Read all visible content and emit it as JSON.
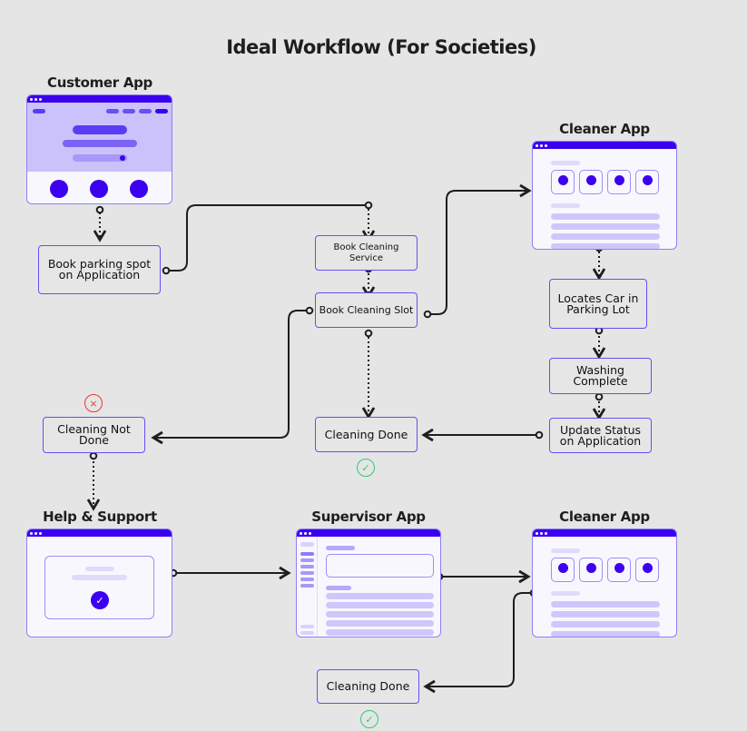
{
  "title": "Ideal Workflow (For Societies)",
  "colors": {
    "accent": "#3b00f0",
    "node_border": "#6a4df5",
    "window_bg": "#f8f7fe",
    "placeholder": "#cfc7fb",
    "success": "#2ecc71",
    "error": "#e53935",
    "background": "#e5e5e5"
  },
  "apps": {
    "customer": "Customer App",
    "cleaner_top": "Cleaner App",
    "help": "Help & Support",
    "supervisor": "Supervisor App",
    "cleaner_bottom": "Cleaner App"
  },
  "nodes": {
    "book_parking": "Book parking spot on Application",
    "book_service": "Book Cleaning Service",
    "book_slot": "Book Cleaning Slot",
    "locates_car": "Locates Car in Parking Lot",
    "washing_complete": "Washing Complete",
    "update_status": "Update Status on Application",
    "cleaning_done": "Cleaning Done",
    "cleaning_not_done": "Cleaning Not Done",
    "cleaning_done_final": "Cleaning Done"
  },
  "icons": {
    "fail": "×",
    "ok": "✓",
    "check": "✓"
  }
}
